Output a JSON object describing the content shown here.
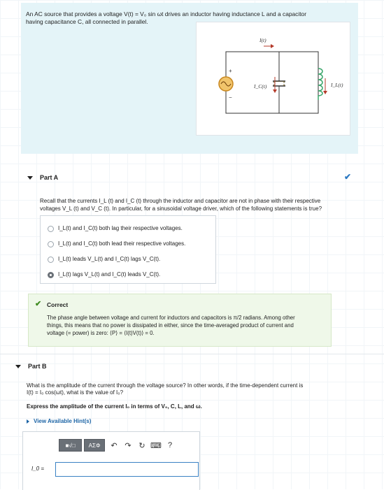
{
  "intro": {
    "line1": "An AC source that provides a voltage V(t) = V₀ sin ωt drives an inductor having inductance L and a capacitor",
    "line2": "having capacitance C, all connected in parallel.",
    "circuit": {
      "label_total": "I(t)",
      "label_cap": "I_C(t)",
      "label_ind": "I_L(t)",
      "plus": "+",
      "minus": "−"
    }
  },
  "part_a": {
    "title": "Part A",
    "question_line1": "Recall that the currents I_L (t) and I_C (t) through the inductor and capacitor are not in phase with their respective",
    "question_line2": "voltages V_L (t) and V_C (t). In particular, for a sinusoidal voltage driver, which of the following statements is true?",
    "options": [
      "I_L(t) and I_C(t) both lag their respective voltages.",
      "I_L(t) and I_C(t) both lead their respective voltages.",
      "I_L(t) leads V_L(t) and I_C(t) lags V_C(t).",
      "I_L(t) lags V_L(t) and I_C(t) leads V_C(t)."
    ],
    "selected_index": 3,
    "correct": {
      "title": "Correct",
      "text_line1": "The phase angle between voltage and current for inductors and capacitors is π/2 radians. Among other",
      "text_line2": "things, this means that no power is dissipated in either, since the time-averaged product of current and",
      "text_line3": "voltage (= power) is zero: ⟨P⟩ = ⟨I(t)V(t)⟩ = 0."
    }
  },
  "part_b": {
    "title": "Part B",
    "question_line1": "What is the amplitude of the current through the voltage source? In other words, if the time-dependent current is",
    "question_line2": "I(t) = I₀ cos(ωt), what is the value of I₀?",
    "instruction": "Express the amplitude of the current I₀ in terms of V₀, C, L, and ω.",
    "hint": "View Available Hint(s)",
    "toolbar": {
      "templates": "■√□",
      "symbols": "ΑΣΦ",
      "help": "?"
    },
    "answer_label": "I_0 =",
    "answer_value": ""
  },
  "colors": {
    "intro_bg": "#e4f4f8",
    "correct_bg": "#eff8e9",
    "accent_blue": "#2b79c2",
    "correct_green": "#3e8a1f"
  }
}
